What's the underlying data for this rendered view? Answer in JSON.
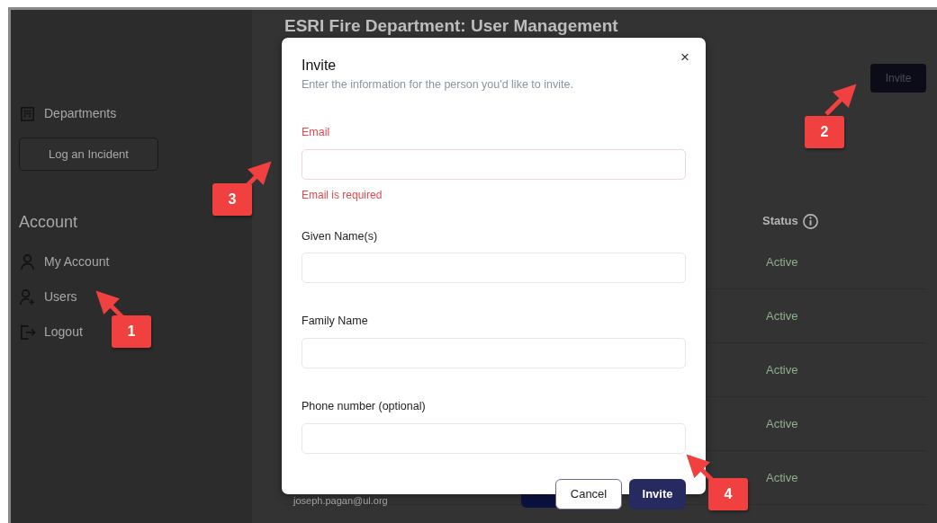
{
  "sidebar": {
    "items": [
      {
        "kind": "link",
        "label": "Departments"
      },
      {
        "kind": "button",
        "label": "Log an Incident"
      },
      {
        "kind": "heading",
        "label": "Account"
      },
      {
        "kind": "link",
        "label": "My Account"
      },
      {
        "kind": "link",
        "label": "Users"
      },
      {
        "kind": "link",
        "label": "Logout"
      }
    ]
  },
  "page": {
    "title": "ESRI Fire Department: User Management",
    "invite_button": "Invite",
    "table": {
      "status_header": "Status",
      "rows": [
        {
          "status": "Active"
        },
        {
          "status": "Active"
        },
        {
          "status": "Active"
        },
        {
          "status": "Active"
        },
        {
          "email": "joseph.pagan@ul.org",
          "status": "Active"
        }
      ]
    }
  },
  "modal": {
    "title": "Invite",
    "subtitle": "Enter the information for the person you'd like to invite.",
    "close": "×",
    "fields": [
      {
        "label": "Email",
        "invalid": true,
        "error": "Email is required"
      },
      {
        "label": "Given Name(s)",
        "invalid": false
      },
      {
        "label": "Family Name",
        "invalid": false
      },
      {
        "label": "Phone number (optional)",
        "invalid": false
      }
    ],
    "buttons": [
      {
        "kind": "secondary",
        "label": "Cancel"
      },
      {
        "kind": "primary",
        "label": "Invite"
      }
    ]
  },
  "callouts": [
    {
      "number": "1"
    },
    {
      "number": "2"
    },
    {
      "number": "3"
    },
    {
      "number": "4"
    }
  ]
}
